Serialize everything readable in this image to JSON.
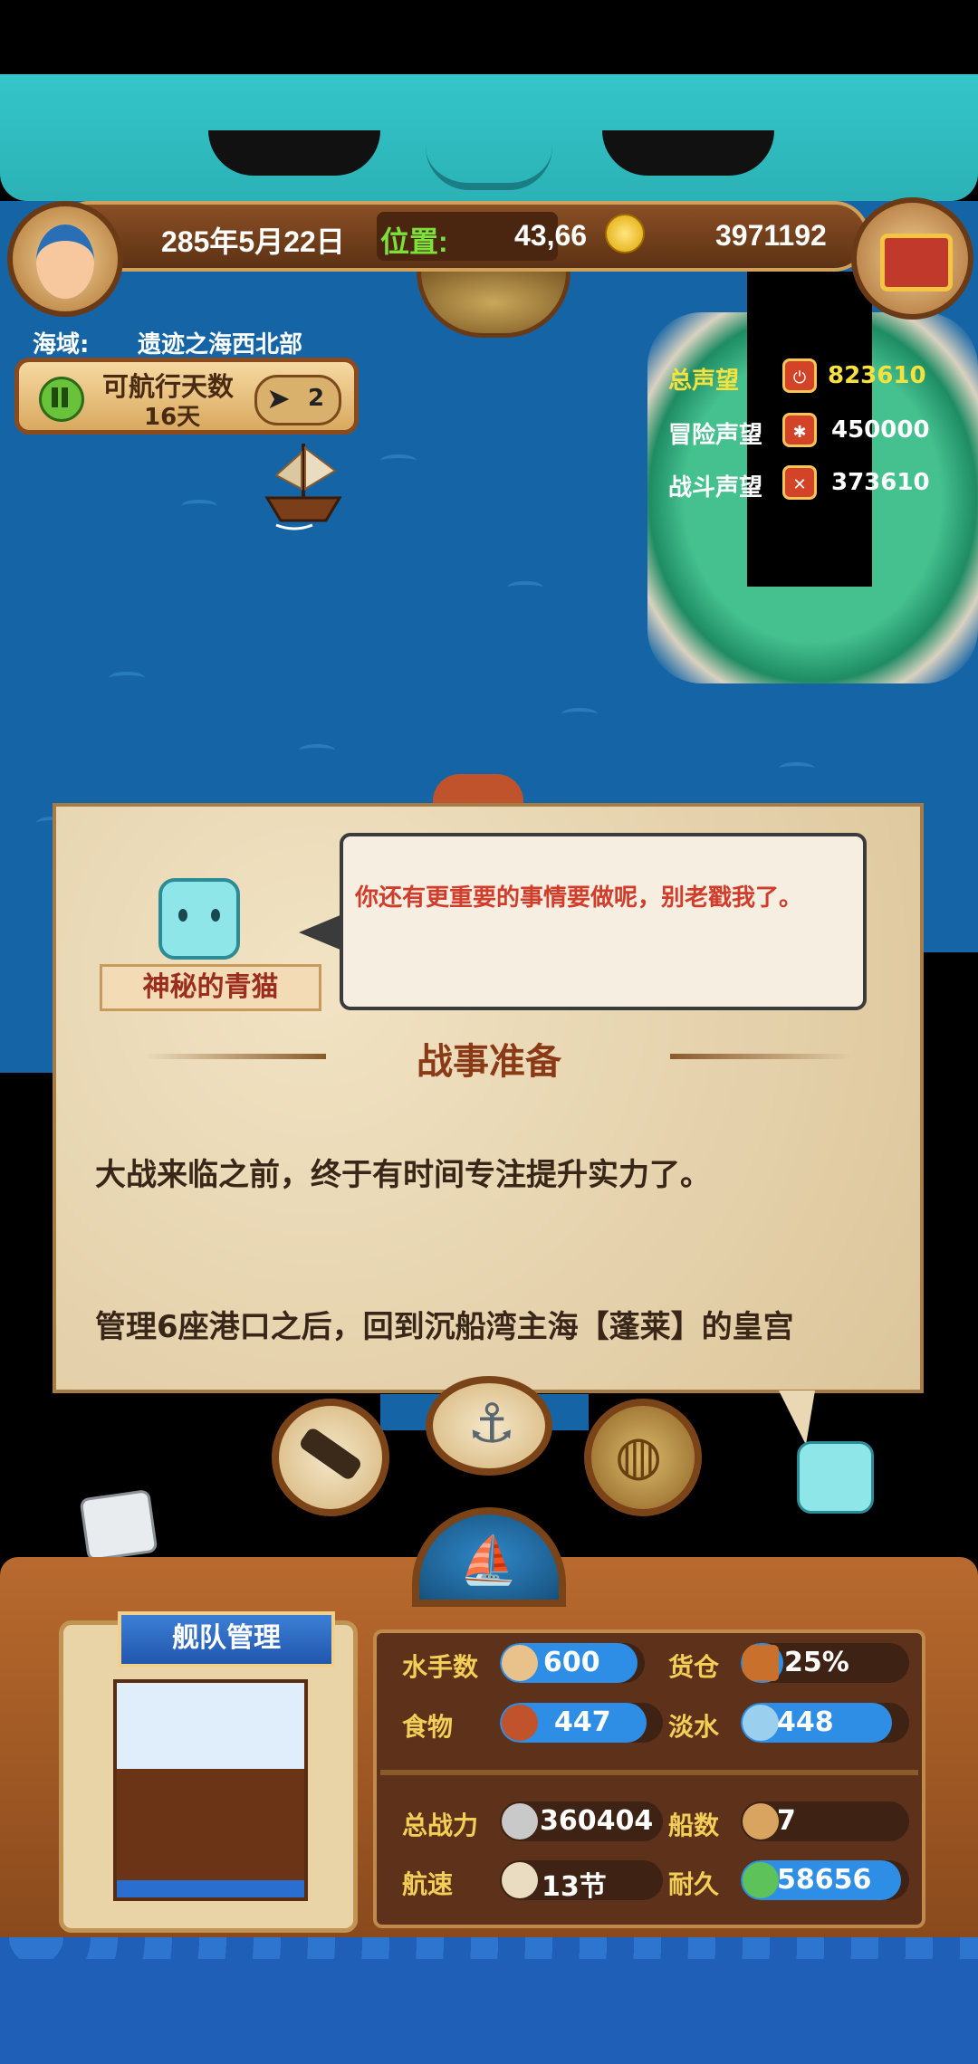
{
  "header": {
    "date": "285年5月22日",
    "position_label": "位置:",
    "position_value": "43,66",
    "gold": "3971192"
  },
  "sea_area": {
    "label": "海域:",
    "name": "遗迹之海西北部"
  },
  "voyage": {
    "label": "可航行天数",
    "days": "16天",
    "compass_count": "2"
  },
  "reputation": [
    {
      "label": "总声望",
      "value": "823610",
      "color": "#f5e23c"
    },
    {
      "label": "冒险声望",
      "value": "450000",
      "color": "#ffffff"
    },
    {
      "label": "战斗声望",
      "value": "373610",
      "color": "#ffffff"
    }
  ],
  "dialog": {
    "speech": "你还有更重要的事情要做呢，别老戳我了。",
    "speaker": "神秘的青猫",
    "title": "战事准备",
    "line1": "大战来临之前，终于有时间专注提升实力了。",
    "line2": "管理6座港口之后，回到沉船湾主海【蓬莱】的皇宫"
  },
  "fleet": {
    "title": "舰队管理",
    "stats": {
      "sailors_label": "水手数",
      "sailors": "600",
      "sailors_fill": 0.95,
      "cargo_label": "货仓",
      "cargo": "25%",
      "cargo_fill": 0.25,
      "food_label": "食物",
      "food": "447",
      "food_fill": 0.9,
      "water_label": "淡水",
      "water": "448",
      "water_fill": 0.9,
      "power_label": "总战力",
      "power": "360404",
      "ships_label": "船数",
      "ships": "7",
      "speed_label": "航速",
      "speed": "13节",
      "durability_label": "耐久",
      "durability": "58656",
      "durability_fill": 0.95
    }
  },
  "colors": {
    "sea": "#1565a6",
    "accent_blue": "#2e8ee6",
    "wood": "#8a4a1c",
    "title_brown": "#8a3a16",
    "speech_red": "#d23c2b"
  }
}
